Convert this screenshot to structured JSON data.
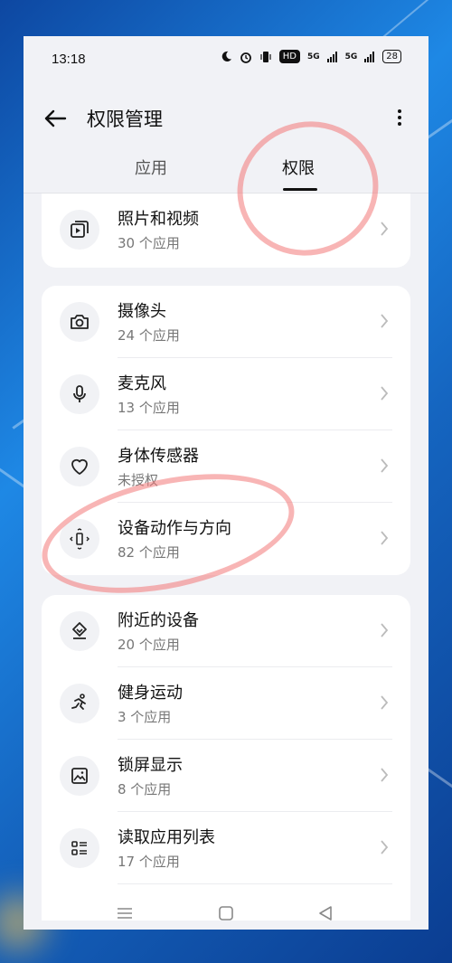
{
  "status_bar": {
    "time": "13:18",
    "battery": "28",
    "hd": "HD",
    "sig1": "5G",
    "sig2": "5G"
  },
  "header": {
    "title": "权限管理"
  },
  "tabs": [
    {
      "label": "应用"
    },
    {
      "label": "权限"
    }
  ],
  "groups": [
    {
      "items": [
        {
          "label": "照片和视频",
          "sub": "30 个应用",
          "icon": "photo-video-icon"
        }
      ]
    },
    {
      "items": [
        {
          "label": "摄像头",
          "sub": "24 个应用",
          "icon": "camera-icon"
        },
        {
          "label": "麦克风",
          "sub": "13 个应用",
          "icon": "microphone-icon"
        },
        {
          "label": "身体传感器",
          "sub": "未授权",
          "icon": "heart-icon"
        },
        {
          "label": "设备动作与方向",
          "sub": "82 个应用",
          "icon": "device-motion-icon"
        }
      ]
    },
    {
      "items": [
        {
          "label": "附近的设备",
          "sub": "20 个应用",
          "icon": "nearby-devices-icon"
        },
        {
          "label": "健身运动",
          "sub": "3 个应用",
          "icon": "running-icon"
        },
        {
          "label": "锁屏显示",
          "sub": "8 个应用",
          "icon": "lockscreen-image-icon"
        },
        {
          "label": "读取应用列表",
          "sub": "17 个应用",
          "icon": "app-list-icon"
        }
      ]
    }
  ],
  "colors": {
    "accent": "#111111",
    "annotation": "#f27878"
  }
}
